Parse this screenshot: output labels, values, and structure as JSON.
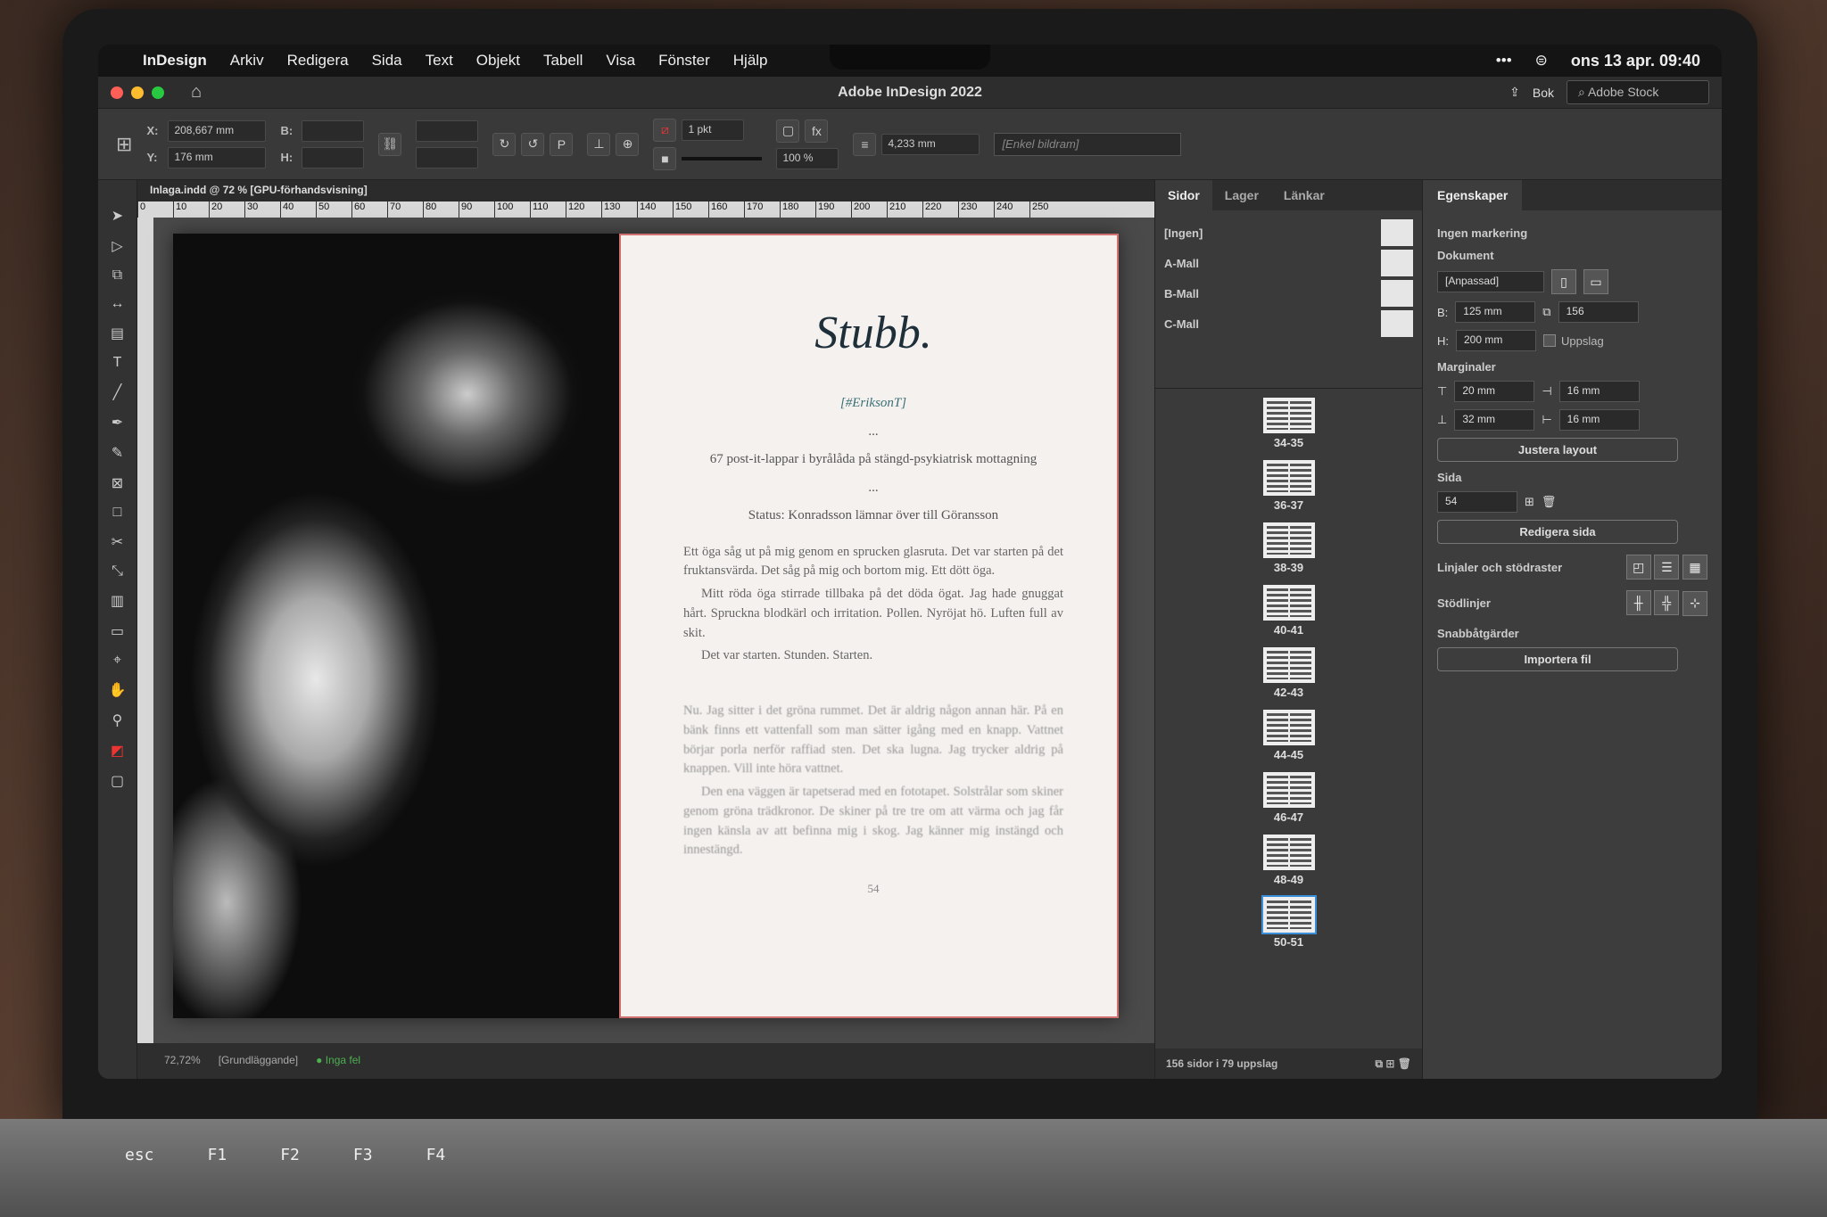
{
  "menubar": {
    "app": "InDesign",
    "items": [
      "Arkiv",
      "Redigera",
      "Sida",
      "Text",
      "Objekt",
      "Tabell",
      "Visa",
      "Fönster",
      "Hjälp"
    ],
    "clock": "ons 13 apr. 09:40"
  },
  "titlebar": {
    "title": "Adobe InDesign 2022",
    "workspace": "Bok",
    "stock_search": "Adobe Stock"
  },
  "control": {
    "x_label": "X:",
    "x_value": "208,667 mm",
    "y_label": "Y:",
    "y_value": "176 mm",
    "w_label": "B:",
    "h_label": "H:",
    "stroke_weight": "1 pkt",
    "scale": "100 %",
    "width_field": "4,233 mm",
    "object_style": "[Enkel bildram]"
  },
  "document": {
    "tab": "Inlaga.indd @ 72 % [GPU-förhandsvisning]",
    "ruler_ticks": [
      "0",
      "10",
      "20",
      "30",
      "40",
      "50",
      "60",
      "70",
      "80",
      "90",
      "100",
      "110",
      "120",
      "130",
      "140",
      "150",
      "160",
      "170",
      "180",
      "190",
      "200",
      "210",
      "220",
      "230",
      "240",
      "250"
    ],
    "story_title": "Stubb.",
    "author": "[#EriksonT]",
    "sep1": "...",
    "subtitle": "67 post-it-lappar i byrålåda på stängd-psykiatrisk mottagning",
    "sep2": "...",
    "status": "Status: Konradsson lämnar över till Göransson",
    "para1": "Ett öga såg ut på mig genom en sprucken glasruta. Det var starten på det fruktansvärda. Det såg på mig och bortom mig. Ett dött öga.",
    "para2": "Mitt röda öga stirrade tillbaka på det döda ögat. Jag hade gnuggat hårt. Spruckna blodkärl och irritation. Pollen. Nyröjat hö. Luften full av skit.",
    "para3": "Det var starten. Stunden. Starten.",
    "para4": "Nu. Jag sitter i det gröna rummet. Det är aldrig någon annan här. På en bänk finns ett vattenfall som man sätter igång med en knapp. Vattnet börjar porla nerför raffiad sten. Det ska lugna. Jag trycker aldrig på knappen. Vill inte höra vattnet.",
    "para5": "Den ena väggen är tapetserad med en fototapet. Solstrålar som skiner genom gröna trädkronor. De skiner på tre tre om att värma och jag får ingen känsla av att befinna mig i skog. Jag känner mig instängd och innestängd.",
    "page_number": "54",
    "statusbar_style": "[Grundläggande]",
    "statusbar_errors": "Inga fel"
  },
  "pages_panel": {
    "tabs": [
      "Sidor",
      "Lager",
      "Länkar"
    ],
    "masters": [
      "[Ingen]",
      "A-Mall",
      "B-Mall",
      "C-Mall"
    ],
    "spreads": [
      "34-35",
      "36-37",
      "38-39",
      "40-41",
      "42-43",
      "44-45",
      "46-47",
      "48-49",
      "50-51"
    ],
    "footer": "156 sidor i 79 uppslag"
  },
  "properties": {
    "tab": "Egenskaper",
    "selection": "Ingen markering",
    "document_heading": "Dokument",
    "preset": "[Anpassad]",
    "width_label": "B:",
    "width": "125 mm",
    "height_label": "H:",
    "height": "200 mm",
    "pages": "156",
    "facing_pages": "Uppslag",
    "margins_heading": "Marginaler",
    "margin_top": "20 mm",
    "margin_bottom": "32 mm",
    "margin_inside": "16 mm",
    "margin_outside": "16 mm",
    "adjust_layout": "Justera layout",
    "page_heading": "Sida",
    "page_value": "54",
    "edit_page": "Redigera sida",
    "rulers_heading": "Linjaler och stödraster",
    "guides_heading": "Stödlinjer",
    "quick_actions_heading": "Snabbåtgärder",
    "import_file": "Importera fil"
  },
  "keyboard": [
    "esc",
    "F1",
    "F2",
    "F3",
    "F4"
  ],
  "colors": {
    "accent": "#3a8fd8",
    "bleed": "#d07070",
    "title_ink": "#1f2f3a"
  }
}
